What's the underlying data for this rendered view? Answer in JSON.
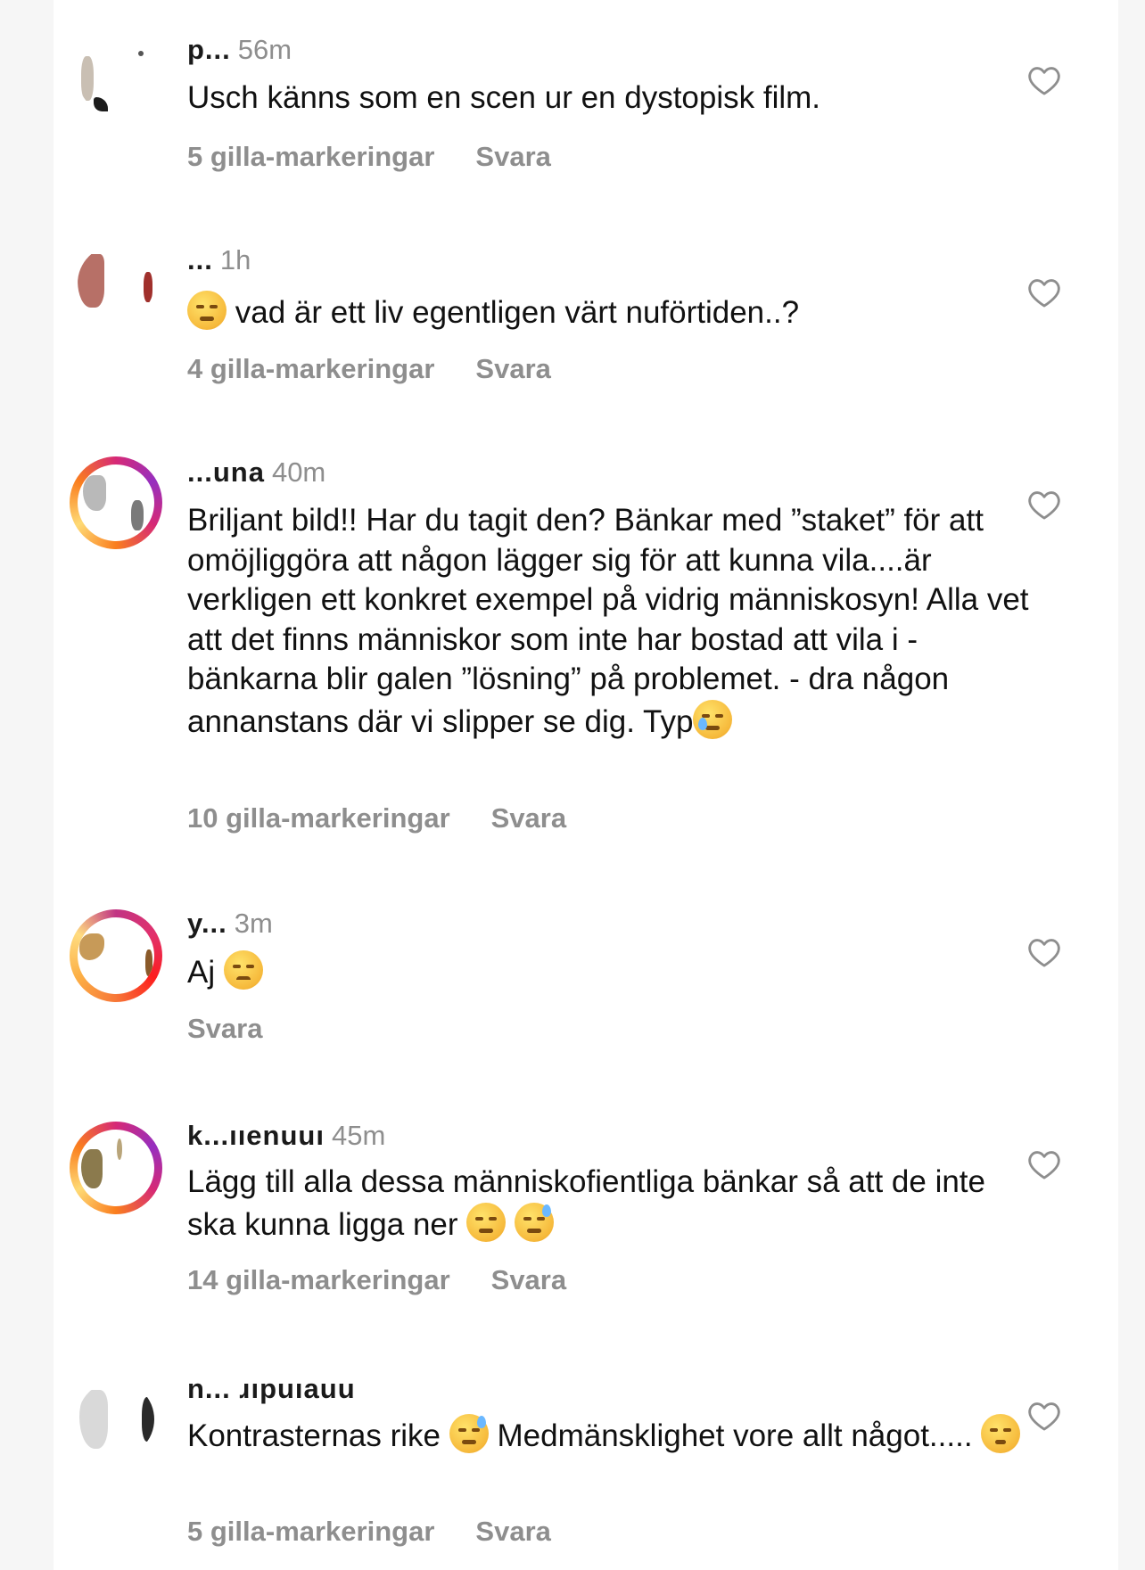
{
  "colors": {
    "background": "#ffffff",
    "text": "#111111",
    "secondary": "#8e8e8e",
    "story_ring": "#d62976"
  },
  "comments": [
    {
      "username": "p...",
      "time": "56m",
      "text_parts": [
        "Usch känns som en scen ur en dystopisk film."
      ],
      "likes": "5 gilla-markeringar",
      "reply": "Svara",
      "avatar_ring": "none"
    },
    {
      "username": "...",
      "time": "1h",
      "text_parts": [
        "vad är ett liv egentligen värt nuförtiden..?"
      ],
      "leading_emoji": "pensive-face-emoji",
      "likes": "4 gilla-markeringar",
      "reply": "Svara",
      "avatar_ring": "none"
    },
    {
      "username": "...una",
      "time": "40m",
      "text_parts": [
        "Briljant bild!! Har du tagit den? Bänkar med ”staket” för att omöjliggöra att någon lägger sig för att kunna vila....är verkligen ett konkret exempel på vidrig människosyn! Alla vet att det finns människor som inte har bostad att vila i - bänkarna blir galen ”lösning” på problemet. - dra någon annanstans där vi slipper se dig. Typ"
      ],
      "trailing_emoji": "crying-face-emoji",
      "likes": "10 gilla-markeringar",
      "reply": "Svara",
      "avatar_ring": "story"
    },
    {
      "username": "y...",
      "time": "3m",
      "text_parts": [
        "Aj"
      ],
      "trailing_emoji": "disappointed-face-emoji",
      "likes": "",
      "reply": "Svara",
      "avatar_ring": "story2"
    },
    {
      "username": "k...ııenuuı",
      "time": "45m",
      "text_parts": [
        "Lägg till alla dessa människofientliga bänkar så att de inte ska kunna ligga ner"
      ],
      "trailing_emoji": "triumph-face-emoji",
      "trailing_emoji_2": "downcast-sweat-face-emoji",
      "likes": "14 gilla-markeringar",
      "reply": "Svara",
      "avatar_ring": "story"
    },
    {
      "username": "n... ɹıpuıauu",
      "time": "",
      "text_parts": [
        "Kontrasternas rike",
        "Medmänsklighet vore allt något....."
      ],
      "mid_emoji": "downcast-sweat-face-emoji",
      "trailing_emoji": "unamused-face-emoji",
      "likes": "5 gilla-markeringar",
      "reply": "Svara",
      "avatar_ring": "none"
    }
  ]
}
